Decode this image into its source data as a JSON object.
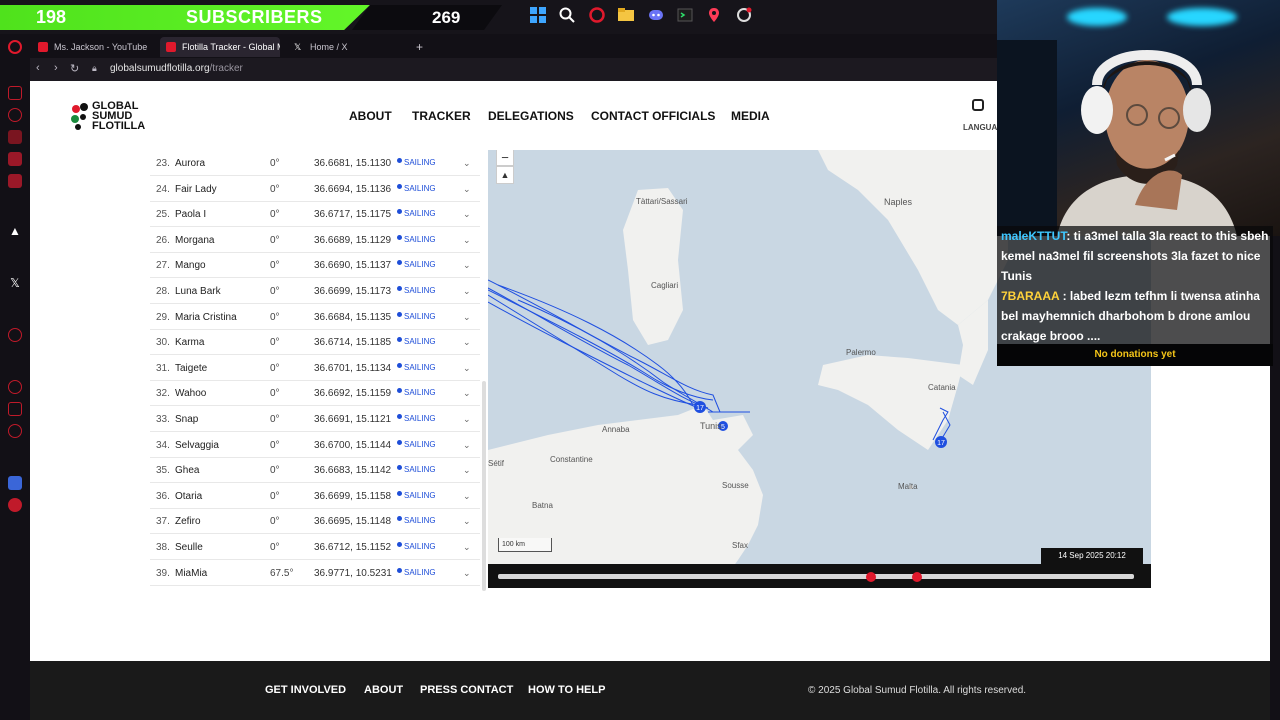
{
  "overlay": {
    "subscribers_count": "198",
    "subscribers_label": "SUBSCRIBERS",
    "viewer_count": "269"
  },
  "browser": {
    "tabs": [
      {
        "label": "Ms. Jackson - YouTube",
        "icon": "youtube-icon"
      },
      {
        "label": "Flotilla Tracker - Global M",
        "icon": "flotilla-icon"
      },
      {
        "label": "Home / X",
        "icon": "x-icon"
      }
    ],
    "url_domain": "globalsumudflotilla.org",
    "url_path": "/tracker"
  },
  "site": {
    "logo_text": "GLOBAL\nSUMUD\nFLOTILLA",
    "nav": [
      "ABOUT",
      "TRACKER",
      "DELEGATIONS",
      "CONTACT OFFICIALS",
      "MEDIA"
    ],
    "language_label": "LANGUA"
  },
  "vessels": [
    {
      "idx": "23.",
      "name": "Aurora",
      "heading": "0°",
      "coords": "36.6681, 15.1130",
      "status": "SAILING"
    },
    {
      "idx": "24.",
      "name": "Fair Lady",
      "heading": "0°",
      "coords": "36.6694, 15.1136",
      "status": "SAILING"
    },
    {
      "idx": "25.",
      "name": "Paola I",
      "heading": "0°",
      "coords": "36.6717, 15.1175",
      "status": "SAILING"
    },
    {
      "idx": "26.",
      "name": "Morgana",
      "heading": "0°",
      "coords": "36.6689, 15.1129",
      "status": "SAILING"
    },
    {
      "idx": "27.",
      "name": "Mango",
      "heading": "0°",
      "coords": "36.6690, 15.1137",
      "status": "SAILING"
    },
    {
      "idx": "28.",
      "name": "Luna Bark",
      "heading": "0°",
      "coords": "36.6699, 15.1173",
      "status": "SAILING"
    },
    {
      "idx": "29.",
      "name": "Maria Cristina",
      "heading": "0°",
      "coords": "36.6684, 15.1135",
      "status": "SAILING"
    },
    {
      "idx": "30.",
      "name": "Karma",
      "heading": "0°",
      "coords": "36.6714, 15.1185",
      "status": "SAILING"
    },
    {
      "idx": "31.",
      "name": "Taigete",
      "heading": "0°",
      "coords": "36.6701, 15.1134",
      "status": "SAILING"
    },
    {
      "idx": "32.",
      "name": "Wahoo",
      "heading": "0°",
      "coords": "36.6692, 15.1159",
      "status": "SAILING"
    },
    {
      "idx": "33.",
      "name": "Snap",
      "heading": "0°",
      "coords": "36.6691, 15.1121",
      "status": "SAILING"
    },
    {
      "idx": "34.",
      "name": "Selvaggia",
      "heading": "0°",
      "coords": "36.6700, 15.1144",
      "status": "SAILING"
    },
    {
      "idx": "35.",
      "name": "Ghea",
      "heading": "0°",
      "coords": "36.6683, 15.1142",
      "status": "SAILING"
    },
    {
      "idx": "36.",
      "name": "Otaria",
      "heading": "0°",
      "coords": "36.6699, 15.1158",
      "status": "SAILING"
    },
    {
      "idx": "37.",
      "name": "Zefiro",
      "heading": "0°",
      "coords": "36.6695, 15.1148",
      "status": "SAILING"
    },
    {
      "idx": "38.",
      "name": "Seulle",
      "heading": "0°",
      "coords": "36.6712, 15.1152",
      "status": "SAILING"
    },
    {
      "idx": "39.",
      "name": "MiaMia",
      "heading": "67.5°",
      "coords": "36.9771, 10.5231",
      "status": "SAILING"
    }
  ],
  "map": {
    "zoom_in": "+",
    "zoom_out": "−",
    "reset": "▲",
    "places": {
      "tattari": "Tàttari/Sassari",
      "naples": "Naples",
      "cagliari": "Cagliari",
      "palermo": "Palermo",
      "catania": "Catania",
      "annaba": "Annaba",
      "tunis": "Tunis",
      "setif": "Sétif",
      "constantine": "Constantine",
      "sousse": "Sousse",
      "batna": "Batna",
      "sfax": "Sfax",
      "malta": "Malta"
    },
    "marker_tunis_a": "17",
    "marker_tunis_b": "5",
    "marker_sicily": "17",
    "scale": "100 km",
    "timestamp": "14 Sep 2025 20:12",
    "route_color": "#1f4fe0"
  },
  "footer": {
    "links": [
      "GET INVOLVED",
      "ABOUT",
      "PRESS CONTACT",
      "HOW TO HELP"
    ],
    "copyright": "© 2025 Global Sumud Flotilla. All rights reserved."
  },
  "chat": {
    "messages": [
      {
        "user": "maleKTTUT",
        "text": ": ti a3mel talla 3la react to this sbeh kemel na3mel fil screenshots 3la fazet to nice Tunis"
      },
      {
        "user": "7BARAAA",
        "text": " : labed lezm tefhm li twensa atinha bel mayhemnich dharbohom b drone amlou crakage brooo ...."
      }
    ],
    "donations": "No donations yet"
  }
}
